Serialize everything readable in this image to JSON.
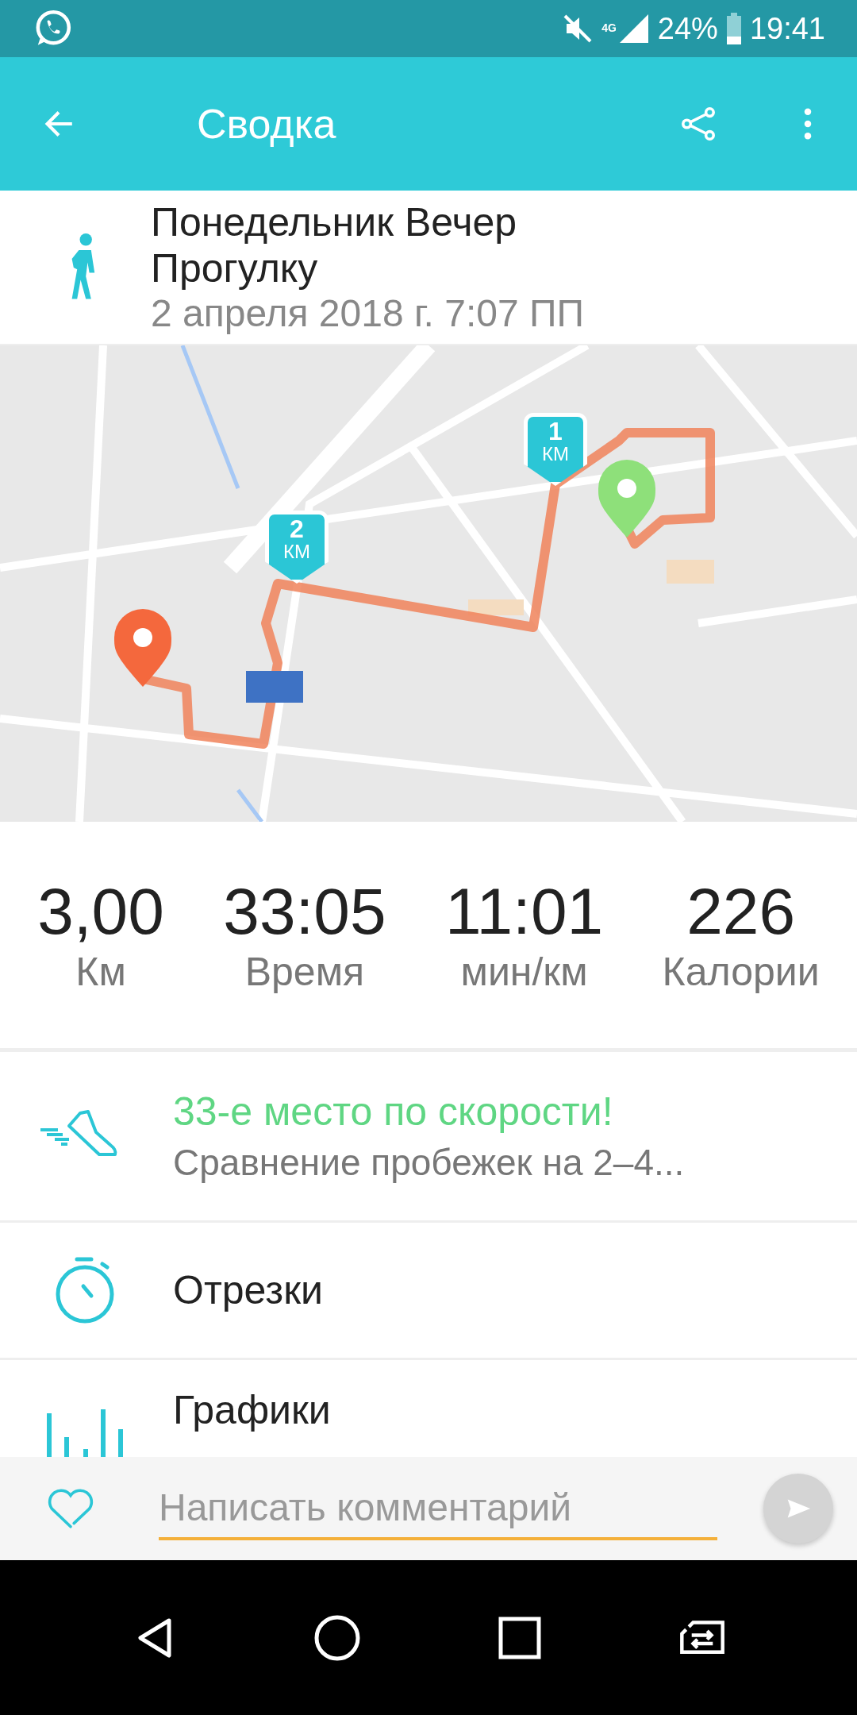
{
  "status_bar": {
    "battery": "24%",
    "time": "19:41",
    "network": "4G"
  },
  "app_bar": {
    "title": "Сводка"
  },
  "activity": {
    "title": "Понедельник Вечер Прогулку",
    "date": "2 апреля 2018 г. 7:07 ПП"
  },
  "map": {
    "kind": "picture",
    "markers": [
      {
        "number": "1",
        "unit": "КМ"
      },
      {
        "number": "2",
        "unit": "КМ"
      }
    ]
  },
  "stats": [
    {
      "value": "3,00",
      "label": "Км"
    },
    {
      "value": "33:05",
      "label": "Время"
    },
    {
      "value": "11:01",
      "label": "мин/км"
    },
    {
      "value": "226",
      "label": "Калории"
    }
  ],
  "rows": [
    {
      "kind": "achievement",
      "title": "33-е место по скорости!",
      "subtitle": "Сравнение пробежек на 2–4..."
    },
    {
      "kind": "splits",
      "title": "Отрезки"
    },
    {
      "kind": "charts",
      "title": "Графики"
    }
  ],
  "comment": {
    "placeholder": "Написать комментарий"
  }
}
